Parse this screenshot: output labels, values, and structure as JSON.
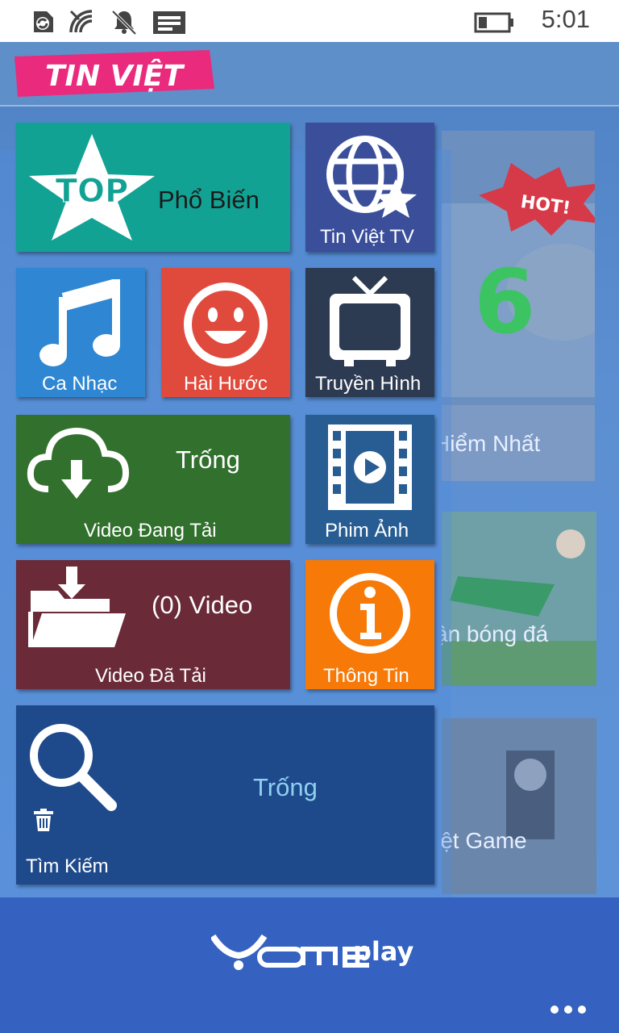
{
  "status_bar": {
    "time": "5:01",
    "icons": [
      "sync-icon",
      "wifi-icon",
      "bell-icon",
      "message-icon",
      "battery-icon"
    ]
  },
  "header": {
    "logo_text": "TIN VIỆT",
    "logo_color": "#ea2a7c"
  },
  "background_news": [
    {
      "label": "Hiểm Nhất",
      "hot_badge": "HOT!"
    },
    {
      "label": "ận bóng đá"
    },
    {
      "label": "iệt  Game"
    }
  ],
  "tiles": {
    "popular": {
      "title": "Phổ Biến",
      "icon_text": "TOP",
      "color": "#12a294"
    },
    "tv_channel": {
      "label": "Tin Việt TV",
      "color": "#3a4e9a"
    },
    "music": {
      "label": "Ca Nhạc",
      "color": "#2f86d2"
    },
    "comedy": {
      "label": "Hài Hước",
      "color": "#e04a3c"
    },
    "television": {
      "label": "Truyền Hình",
      "color": "#2c3a52"
    },
    "downloading": {
      "label": "Video Đang Tải",
      "status": "Trống",
      "color": "#32702e"
    },
    "movies": {
      "label": "Phim Ảnh",
      "color": "#275d92"
    },
    "downloaded": {
      "label": "Video Đã Tải",
      "status": "(0) Video",
      "color": "#6a2a38"
    },
    "info": {
      "label": "Thông Tin",
      "color": "#f77a08"
    },
    "search": {
      "label": "Tìm Kiếm",
      "status": "Trống",
      "color": "#1e4a8c",
      "status_color": "#8fd0f0"
    }
  },
  "app_bar": {
    "brand": "YOME play",
    "more_label": "more-options"
  }
}
